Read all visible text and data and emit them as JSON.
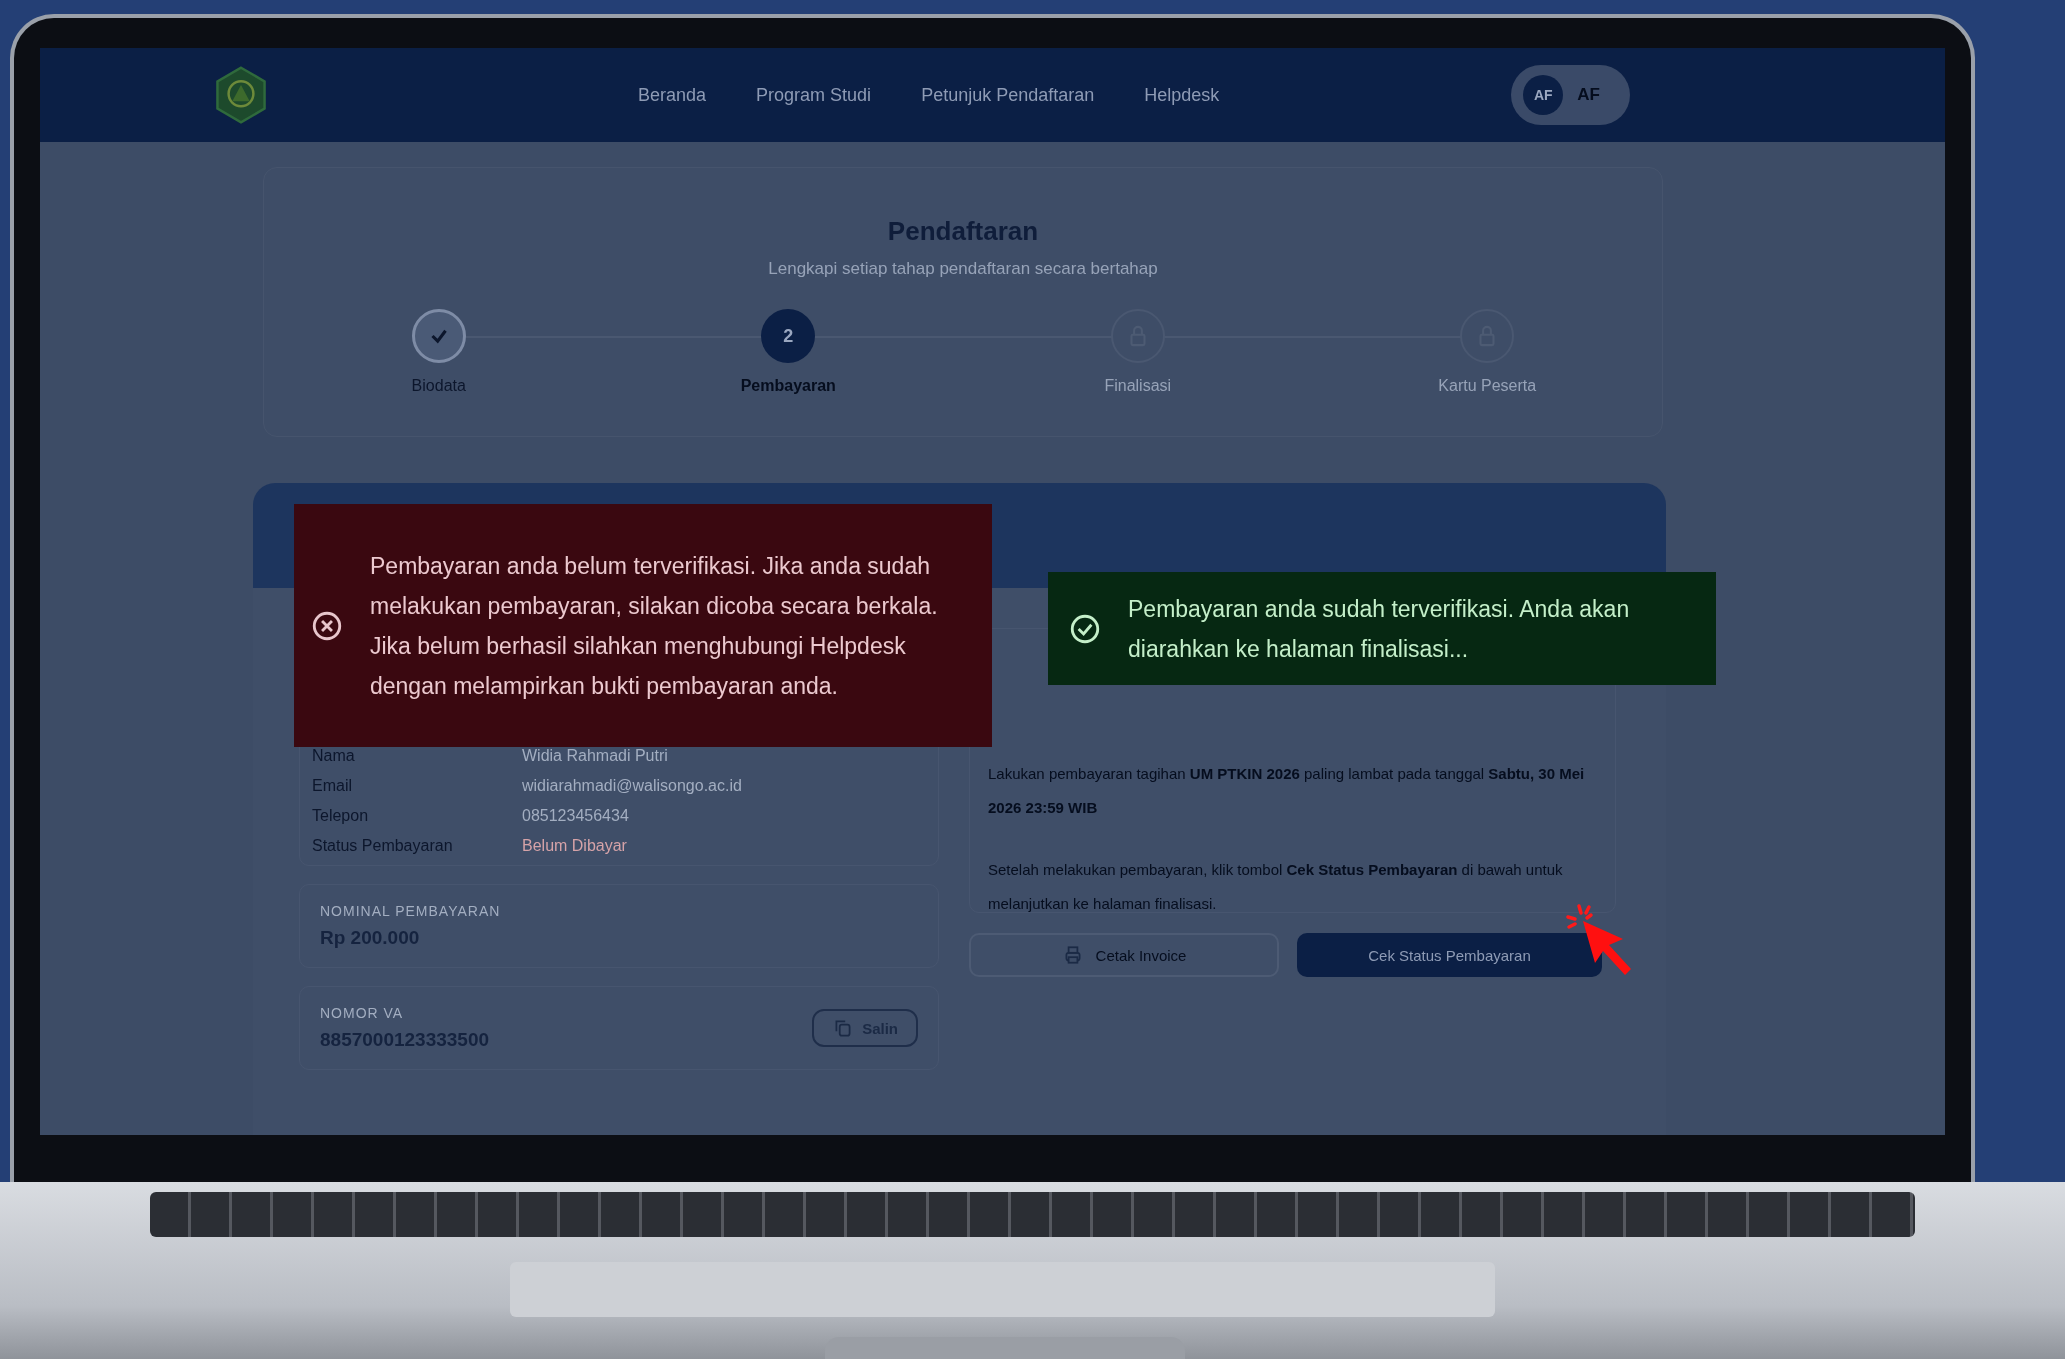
{
  "nav": {
    "links": [
      {
        "label": "Beranda"
      },
      {
        "label": "Program Studi"
      },
      {
        "label": "Petunjuk Pendaftaran"
      },
      {
        "label": "Helpdesk"
      }
    ],
    "user": {
      "initials": "AF",
      "name": "AF"
    }
  },
  "header": {
    "title": "Pendaftaran",
    "subtitle": "Lengkapi setiap tahap pendaftaran secara bertahap"
  },
  "steps": [
    {
      "label": "Biodata",
      "completed": true,
      "current": false
    },
    {
      "label": "Pembayaran",
      "completed": false,
      "current": true,
      "number": "2"
    },
    {
      "label": "Finalisasi",
      "completed": false,
      "current": false
    },
    {
      "label": "Kartu Peserta",
      "completed": false,
      "current": false
    }
  ],
  "applicant": [
    {
      "label": "Nama",
      "value": "Widia Rahmadi Putri",
      "kind": "text"
    },
    {
      "label": "Email",
      "value": "widiarahmadi@walisongo.ac.id",
      "kind": "text"
    },
    {
      "label": "Telepon",
      "value": "085123456434",
      "kind": "text"
    },
    {
      "label": "Status Pembayaran",
      "value": "Belum Dibayar",
      "kind": "status"
    }
  ],
  "amount": {
    "label": "NOMINAL PEMBAYARAN",
    "value": "Rp 200.000"
  },
  "va": {
    "label": "NOMOR VA",
    "value": "8857000123333500",
    "copy_button": "Salin"
  },
  "instructions": [
    "Lakukan pembayaran tagihan **UM PTKIN 2026** paling lambat pada tanggal **Sabtu, 30 Mei 2026 23:59 WIB**",
    "Setelah melakukan pembayaran, klik tombol **Cek Status Pembayaran** di bawah untuk melanjutkan ke halaman finalisasi."
  ],
  "buttons": {
    "invoice": "Cetak Invoice",
    "check": "Cek Status Pembayaran"
  },
  "toasts": [
    {
      "kind": "error",
      "message": "Pembayaran anda belum terverifikasi. Jika anda sudah melakukan pembayaran, silakan dicoba secara berkala. Jika belum berhasil silahkan menghubungi Helpdesk dengan melampirkan bukti pembayaran anda."
    },
    {
      "kind": "success",
      "message": "Pembayaran anda sudah terverifikasi. Anda akan diarahkan ke halaman finalisasi..."
    }
  ]
}
